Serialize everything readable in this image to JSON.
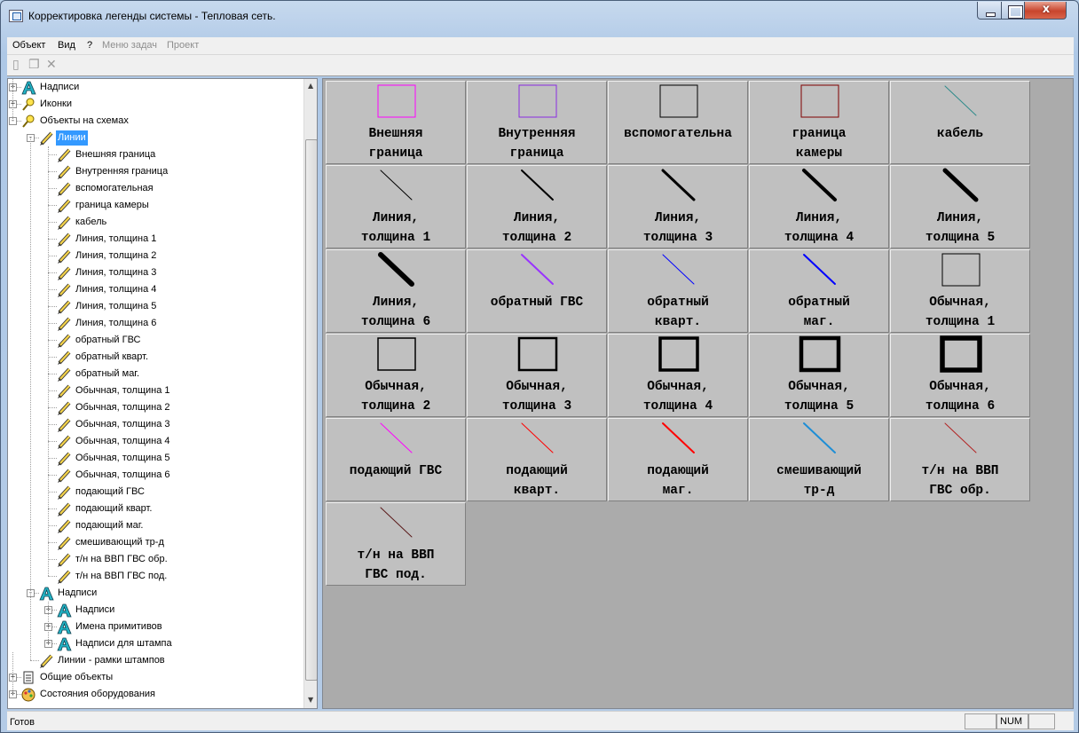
{
  "window": {
    "title": "Корректировка легенды системы - Тепловая сеть.",
    "close_glyph": "x"
  },
  "menu": [
    {
      "label": "Объект",
      "enabled": true
    },
    {
      "label": "Вид",
      "enabled": true
    },
    {
      "label": "?",
      "enabled": true
    },
    {
      "label": "Меню задач",
      "enabled": false
    },
    {
      "label": "Проект",
      "enabled": false
    }
  ],
  "toolbar": [
    {
      "icon": "new-document-icon",
      "glyph": "▯"
    },
    {
      "icon": "properties-icon",
      "glyph": "❐"
    },
    {
      "icon": "delete-icon",
      "glyph": "✕"
    }
  ],
  "tree": [
    {
      "label": "Надписи",
      "icon": "text-a-icon",
      "level": 0,
      "toggle": "+"
    },
    {
      "label": "Иконки",
      "icon": "yellow-key-icon",
      "level": 0,
      "toggle": "+"
    },
    {
      "label": "Объекты на схемах",
      "icon": "yellow-key-icon",
      "level": 0,
      "toggle": "-"
    },
    {
      "label": "Линии",
      "icon": "pencil-icon",
      "level": 1,
      "toggle": "-",
      "selected": true
    },
    {
      "label": "Внешняя граница",
      "icon": "pencil-icon",
      "level": 2
    },
    {
      "label": "Внутренняя граница",
      "icon": "pencil-icon",
      "level": 2
    },
    {
      "label": "вспомогательная",
      "icon": "pencil-icon",
      "level": 2
    },
    {
      "label": "граница камеры",
      "icon": "pencil-icon",
      "level": 2
    },
    {
      "label": "кабель",
      "icon": "pencil-icon",
      "level": 2
    },
    {
      "label": "Линия, толщина 1",
      "icon": "pencil-icon",
      "level": 2
    },
    {
      "label": "Линия, толщина 2",
      "icon": "pencil-icon",
      "level": 2
    },
    {
      "label": "Линия, толщина 3",
      "icon": "pencil-icon",
      "level": 2
    },
    {
      "label": "Линия, толщина 4",
      "icon": "pencil-icon",
      "level": 2
    },
    {
      "label": "Линия, толщина 5",
      "icon": "pencil-icon",
      "level": 2
    },
    {
      "label": "Линия, толщина 6",
      "icon": "pencil-icon",
      "level": 2
    },
    {
      "label": "обратный ГВС",
      "icon": "pencil-icon",
      "level": 2
    },
    {
      "label": "обратный кварт.",
      "icon": "pencil-icon",
      "level": 2
    },
    {
      "label": "обратный маг.",
      "icon": "pencil-icon",
      "level": 2
    },
    {
      "label": "Обычная, толщина 1",
      "icon": "pencil-icon",
      "level": 2
    },
    {
      "label": "Обычная, толщина 2",
      "icon": "pencil-icon",
      "level": 2
    },
    {
      "label": "Обычная, толщина 3",
      "icon": "pencil-icon",
      "level": 2
    },
    {
      "label": "Обычная, толщина 4",
      "icon": "pencil-icon",
      "level": 2
    },
    {
      "label": "Обычная, толщина 5",
      "icon": "pencil-icon",
      "level": 2
    },
    {
      "label": "Обычная, толщина 6",
      "icon": "pencil-icon",
      "level": 2
    },
    {
      "label": "подающий ГВС",
      "icon": "pencil-icon",
      "level": 2
    },
    {
      "label": "подающий кварт.",
      "icon": "pencil-icon",
      "level": 2
    },
    {
      "label": "подающий маг.",
      "icon": "pencil-icon",
      "level": 2
    },
    {
      "label": "смешивающий тр-д",
      "icon": "pencil-icon",
      "level": 2
    },
    {
      "label": "т/н на ВВП ГВС обр.",
      "icon": "pencil-icon",
      "level": 2
    },
    {
      "label": "т/н на ВВП ГВС под.",
      "icon": "pencil-icon",
      "level": 2
    },
    {
      "label": "Надписи",
      "icon": "text-a-icon",
      "level": 1,
      "toggle": "-"
    },
    {
      "label": "Надписи",
      "icon": "text-a-icon",
      "level": 2,
      "toggle": "+"
    },
    {
      "label": "Имена примитивов",
      "icon": "text-a-icon",
      "level": 2,
      "toggle": "+"
    },
    {
      "label": "Надписи для штампа",
      "icon": "text-a-icon",
      "level": 2,
      "toggle": "+"
    },
    {
      "label": "Линии - рамки штампов",
      "icon": "pencil-icon",
      "level": 1
    },
    {
      "label": "Общие объекты",
      "icon": "document-icon",
      "level": 0,
      "toggle": "+"
    },
    {
      "label": "Состояния оборудования",
      "icon": "palette-icon",
      "level": 0,
      "toggle": "+"
    }
  ],
  "legend": [
    {
      "label": "Внешняя\nграница",
      "kind": "rect",
      "color": "#ff00ff",
      "stroke": 1
    },
    {
      "label": "Внутренняя\nграница",
      "kind": "rect",
      "color": "#8a2be2",
      "stroke": 1
    },
    {
      "label": "вспомогательна",
      "kind": "rect",
      "color": "#000000",
      "stroke": 1
    },
    {
      "label": "граница\nкамеры",
      "kind": "rect",
      "color": "#800000",
      "stroke": 1
    },
    {
      "label": "кабель",
      "kind": "line",
      "color": "#2e8b8b",
      "stroke": 1
    },
    {
      "label": "Линия,\nтолщина 1",
      "kind": "line",
      "color": "#000000",
      "stroke": 1
    },
    {
      "label": "Линия,\nтолщина 2",
      "kind": "line",
      "color": "#000000",
      "stroke": 2
    },
    {
      "label": "Линия,\nтолщина 3",
      "kind": "line",
      "color": "#000000",
      "stroke": 3
    },
    {
      "label": "Линия,\nтолщина 4",
      "kind": "line",
      "color": "#000000",
      "stroke": 4
    },
    {
      "label": "Линия,\nтолщина 5",
      "kind": "line",
      "color": "#000000",
      "stroke": 5
    },
    {
      "label": "Линия,\nтолщина 6",
      "kind": "line",
      "color": "#000000",
      "stroke": 6
    },
    {
      "label": "обратный ГВС",
      "kind": "line",
      "color": "#9933ff",
      "stroke": 2
    },
    {
      "label": "обратный\nкварт.",
      "kind": "line",
      "color": "#0000ff",
      "stroke": 1
    },
    {
      "label": "обратный\nмаг.",
      "kind": "line",
      "color": "#0000ff",
      "stroke": 2
    },
    {
      "label": "Обычная,\nтолщина 1",
      "kind": "rect",
      "color": "#000000",
      "stroke": 1
    },
    {
      "label": "Обычная,\nтолщина 2",
      "kind": "rect",
      "color": "#000000",
      "stroke": 1.5
    },
    {
      "label": "Обычная,\nтолщина 3",
      "kind": "rect",
      "color": "#000000",
      "stroke": 2.5
    },
    {
      "label": "Обычная,\nтолщина 4",
      "kind": "rect",
      "color": "#000000",
      "stroke": 3.5
    },
    {
      "label": "Обычная,\nтолщина 5",
      "kind": "rect",
      "color": "#000000",
      "stroke": 4.5
    },
    {
      "label": "Обычная,\nтолщина 6",
      "kind": "rect",
      "color": "#000000",
      "stroke": 5.5
    },
    {
      "label": "подающий ГВС",
      "kind": "line",
      "color": "#ff00ff",
      "stroke": 1
    },
    {
      "label": "подающий\nкварт.",
      "kind": "line",
      "color": "#ff0000",
      "stroke": 1
    },
    {
      "label": "подающий\nмаг.",
      "kind": "line",
      "color": "#ff0000",
      "stroke": 2
    },
    {
      "label": "смешивающий\nтр-д",
      "kind": "line",
      "color": "#1e8ed6",
      "stroke": 2
    },
    {
      "label": "т/н на ВВП\nГВС обр.",
      "kind": "line",
      "color": "#b22222",
      "stroke": 1
    },
    {
      "label": "т/н на ВВП\nГВС под.",
      "kind": "line",
      "color": "#5a1a1a",
      "stroke": 1
    }
  ],
  "status": {
    "text": "Готов",
    "num": "NUM"
  }
}
